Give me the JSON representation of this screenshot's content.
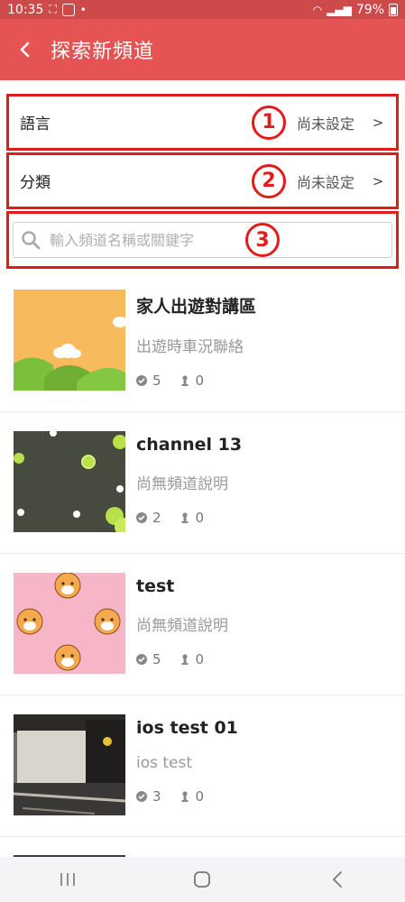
{
  "status_bar": {
    "time": "10:35",
    "battery": "79%"
  },
  "app_bar": {
    "title": "探索新頻道"
  },
  "filters": [
    {
      "label": "語言",
      "marker": "1",
      "value": "尚未設定",
      "chevron": ">"
    },
    {
      "label": "分類",
      "marker": "2",
      "value": "尚未設定",
      "chevron": ">"
    }
  ],
  "search": {
    "placeholder": "輸入頻道名稱或關鍵字",
    "marker": "3"
  },
  "channels": [
    {
      "name": "家人出遊對講區",
      "desc": "出遊時車況聯絡",
      "members": "5",
      "online": "0"
    },
    {
      "name": "channel 13",
      "desc": "尚無頻道說明",
      "members": "2",
      "online": "0"
    },
    {
      "name": "test",
      "desc": "尚無頻道說明",
      "members": "5",
      "online": "0"
    },
    {
      "name": "ios test 01",
      "desc": "ios test",
      "members": "3",
      "online": "0"
    }
  ],
  "colors": {
    "app_bar": "#e65353",
    "status_bar": "#cc4a4a",
    "highlight": "#e31b1b"
  }
}
